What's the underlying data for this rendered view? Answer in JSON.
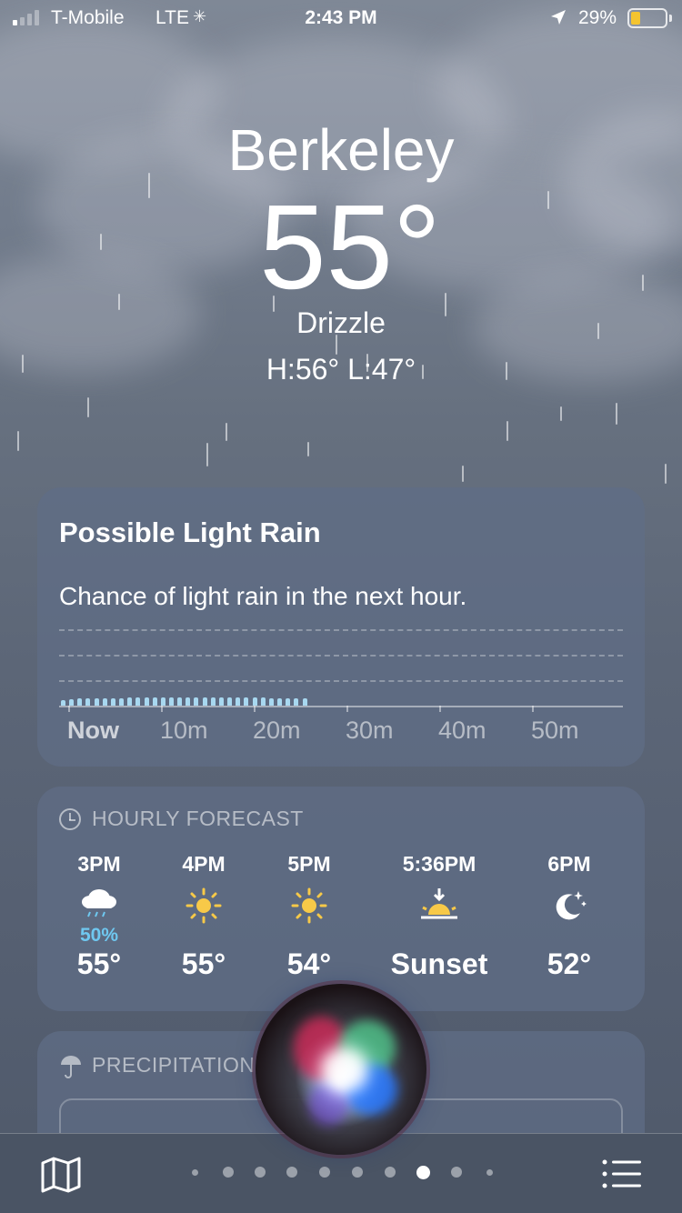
{
  "status_bar": {
    "carrier": "T-Mobile",
    "network": "LTE",
    "time": "2:43 PM",
    "battery_percent": "29%",
    "battery_level": 0.29,
    "battery_color": "#f4c430"
  },
  "weather": {
    "city": "Berkeley",
    "temperature": "55°",
    "condition": "Drizzle",
    "high_low": "H:56°  L:47°"
  },
  "rain_card": {
    "title": "Possible Light Rain",
    "description": "Chance of light rain in the next hour.",
    "axis_labels": [
      "Now",
      "10m",
      "20m",
      "30m",
      "40m",
      "50m"
    ]
  },
  "chart_data": {
    "type": "bar",
    "title": "",
    "x_unit": "minutes",
    "categories": [
      "Now",
      "10m",
      "20m",
      "30m",
      "40m",
      "50m"
    ],
    "series": [
      {
        "values": [
          0.15,
          0.18,
          0.2,
          0.2,
          0.21,
          0.22,
          0.22,
          0.22,
          0.23,
          0.23,
          0.23,
          0.23,
          0.23,
          0.23,
          0.23,
          0.23,
          0.23,
          0.23,
          0.23,
          0.23,
          0.23,
          0.23,
          0.23,
          0.23,
          0.23,
          0.22,
          0.22,
          0.22,
          0.21,
          0.2
        ]
      }
    ],
    "xlim": [
      0,
      60
    ],
    "bar_color": "#a8d8f0",
    "grid": true
  },
  "hourly": {
    "header": "HOURLY FORECAST",
    "items": [
      {
        "time": "3PM",
        "icon": "rain-cloud-icon",
        "precip": "50%",
        "temp": "55°"
      },
      {
        "time": "4PM",
        "icon": "sun-icon",
        "precip": "",
        "temp": "55°"
      },
      {
        "time": "5PM",
        "icon": "sun-icon",
        "precip": "",
        "temp": "54°"
      },
      {
        "time": "5:36PM",
        "icon": "sunset-icon",
        "precip": "",
        "temp": "Sunset"
      },
      {
        "time": "6PM",
        "icon": "moon-stars-icon",
        "precip": "",
        "temp": "52°"
      }
    ]
  },
  "precipitation": {
    "header": "PRECIPITATION"
  },
  "page_indicator": {
    "count": 10,
    "current_index": 7
  },
  "colors": {
    "sun": "#f7c948",
    "precip_text": "#6fc8f0",
    "card": "#606e86"
  }
}
